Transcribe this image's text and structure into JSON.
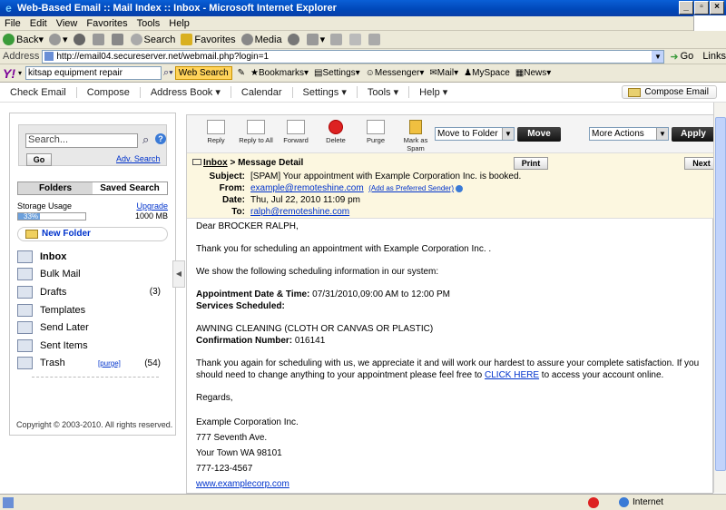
{
  "window": {
    "title": "Web-Based Email :: Mail Index :: Inbox - Microsoft Internet Explorer"
  },
  "menu": [
    "File",
    "Edit",
    "View",
    "Favorites",
    "Tools",
    "Help"
  ],
  "toolbar": {
    "back": "Back",
    "search": "Search",
    "favorites": "Favorites",
    "media": "Media"
  },
  "address": {
    "label": "Address",
    "url": "http://email04.secureserver.net/webmail.php?login=1",
    "go": "Go",
    "links": "Links"
  },
  "yahoo": {
    "logo": "Y!",
    "query": "kitsap equipment repair",
    "web_search": "Web Search",
    "items": [
      "Bookmarks",
      "Settings",
      "Messenger",
      "Mail",
      "MySpace",
      "News"
    ]
  },
  "appnav": {
    "items": [
      "Check Email",
      "Compose",
      "Address Book",
      "Calendar",
      "Settings",
      "Tools",
      "Help"
    ],
    "compose": "Compose Email"
  },
  "sidebar": {
    "search_placeholder": "Search...",
    "go": "Go",
    "adv_search": "Adv. Search",
    "tabs": [
      "Folders",
      "Saved Search"
    ],
    "storage_label": "Storage Usage",
    "upgrade": "Upgrade",
    "storage_pct": "33%",
    "storage_fraction": 0.33,
    "storage_total": "1000 MB",
    "new_folder": "New Folder",
    "folders": [
      {
        "name": "Inbox",
        "count": ""
      },
      {
        "name": "Bulk Mail",
        "count": ""
      },
      {
        "name": "Drafts",
        "count": "(3)"
      },
      {
        "name": "Templates",
        "count": ""
      },
      {
        "name": "Send Later",
        "count": ""
      },
      {
        "name": "Sent Items",
        "count": ""
      },
      {
        "name": "Trash",
        "count": "(54)",
        "purge": "[purge]"
      }
    ],
    "copyright": "Copyright © 2003-2010. All rights reserved."
  },
  "actions": {
    "buttons": [
      "Reply",
      "Reply to All",
      "Forward",
      "Delete",
      "Purge",
      "Mark as Spam"
    ],
    "move_select": "Move to Folder",
    "move": "Move",
    "more_select": "More Actions",
    "apply": "Apply"
  },
  "message": {
    "breadcrumb_link": "Inbox",
    "breadcrumb_rest": " > Message Detail",
    "print": "Print",
    "next": "Next",
    "subject_label": "Subject:",
    "subject": "[SPAM] Your appointment with Example Corporation Inc. is booked.",
    "from_label": "From:",
    "from": "example@remoteshine.com",
    "add_sender": "(Add as Preferred Sender)",
    "date_label": "Date:",
    "date": "Thu, Jul 22, 2010 11:09 pm",
    "to_label": "To:",
    "to": "ralph@remoteshine.com",
    "body": {
      "greeting": "Dear BROCKER RALPH,",
      "p1": "Thank you for scheduling an appointment with Example Corporation Inc. .",
      "p2": "We show the following scheduling information in our system:",
      "appt_label": "Appointment Date & Time:",
      "appt": " 07/31/2010,09:00 AM to 12:00 PM",
      "services_label": "Services Scheduled:",
      "service": "AWNING CLEANING (CLOTH OR CANVAS OR PLASTIC)",
      "conf_label": "Confirmation Number:",
      "conf": " 016141",
      "p3a": "Thank you again for scheduling with us, we appreciate it and will work our hardest to assure your complete satisfaction. If you should need to change anything to your appointment please feel free to ",
      "click_here": "CLICK HERE",
      "p3b": " to access your account online.",
      "regards": "Regards,",
      "sig": [
        "Example Corporation Inc.",
        "777 Seventh Ave.",
        "Your Town WA 98101",
        "777-123-4567"
      ],
      "website": "www.examplecorp.com"
    }
  },
  "status": {
    "zone": "Internet"
  }
}
